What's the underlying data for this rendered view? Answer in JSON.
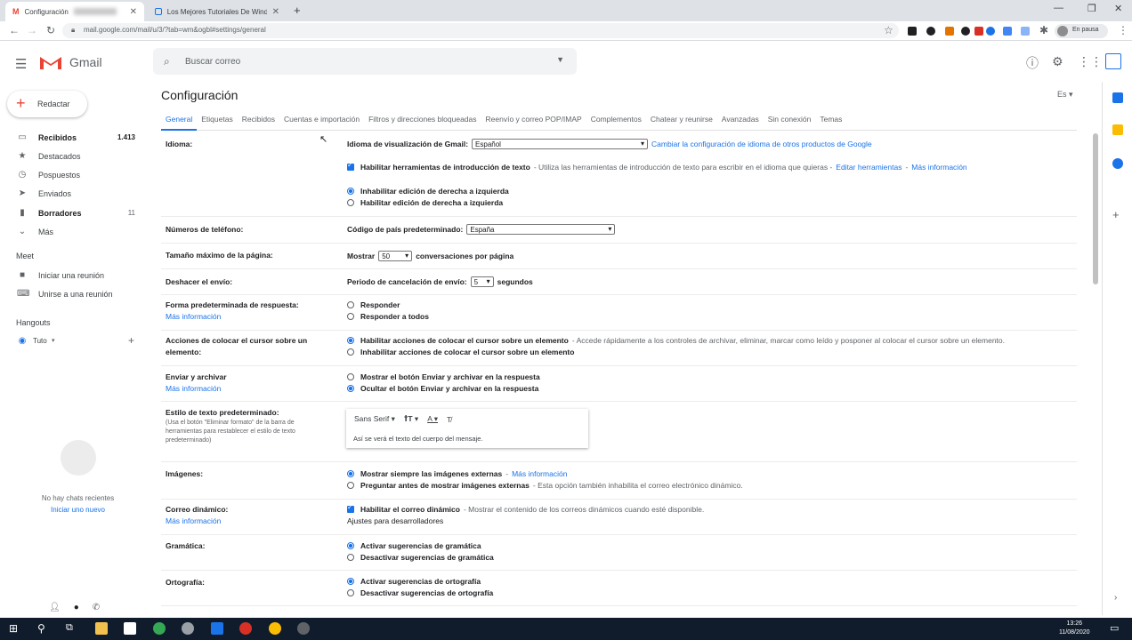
{
  "browser": {
    "tabs": [
      {
        "title": "Configuración",
        "favicon": "gmail-icon",
        "active": true
      },
      {
        "title": "Los Mejores Tutoriales De Windo",
        "favicon": "page-icon",
        "active": false
      }
    ],
    "url": "mail.google.com/mail/u/3/?tab=wm&ogbl#settings/general",
    "profile_status": "En pausa"
  },
  "gmail": {
    "logo_text": "Gmail",
    "search_placeholder": "Buscar correo",
    "compose_label": "Redactar",
    "nav": [
      {
        "icon": "inbox-icon",
        "label": "Recibidos",
        "count": "1.413",
        "bold": true
      },
      {
        "icon": "star-icon",
        "label": "Destacados",
        "count": ""
      },
      {
        "icon": "clock-icon",
        "label": "Pospuestos",
        "count": ""
      },
      {
        "icon": "send-icon",
        "label": "Enviados",
        "count": ""
      },
      {
        "icon": "draft-icon",
        "label": "Borradores",
        "count": "11",
        "bold": true
      },
      {
        "icon": "chevron-down-icon",
        "label": "Más",
        "count": ""
      }
    ],
    "meet": {
      "title": "Meet",
      "items": [
        "Iniciar una reunión",
        "Unirse a una reunión"
      ]
    },
    "hangouts": {
      "title": "Hangouts",
      "user": "Tuto",
      "no_chats": "No hay chats recientes",
      "start_new": "Iniciar uno nuevo"
    }
  },
  "settings": {
    "title": "Configuración",
    "lang_short": "Es",
    "tabs": [
      "General",
      "Etiquetas",
      "Recibidos",
      "Cuentas e importación",
      "Filtros y direcciones bloqueadas",
      "Reenvío y correo POP/IMAP",
      "Complementos",
      "Chatear y reunirse",
      "Avanzadas",
      "Sin conexión",
      "Temas"
    ],
    "idioma": {
      "label": "Idioma:",
      "display_label": "Idioma de visualización de Gmail:",
      "display_value": "Español",
      "other_link": "Cambiar la configuración de idioma de otros productos de Google",
      "tools_label": "Habilitar herramientas de introducción de texto",
      "tools_desc": "- Utiliza las herramientas de introducción de texto para escribir en el idioma que quieras -",
      "tools_edit": "Editar herramientas",
      "tools_sep": "-",
      "tools_more": "Más información",
      "rtl_off": "Inhabilitar edición de derecha a izquierda",
      "rtl_on": "Habilitar edición de derecha a izquierda"
    },
    "telefono": {
      "label": "Números de teléfono:",
      "code_label": "Código de país predeterminado:",
      "code_value": "España"
    },
    "pagina": {
      "label": "Tamaño máximo de la página:",
      "show": "Mostrar",
      "value": "50",
      "suffix": "conversaciones por página"
    },
    "deshacer": {
      "label": "Deshacer el envío:",
      "period_label": "Periodo de cancelación de envío:",
      "value": "5",
      "suffix": "segundos"
    },
    "respuesta": {
      "label": "Forma predeterminada de respuesta:",
      "more": "Más información",
      "opt1": "Responder",
      "opt2": "Responder a todos"
    },
    "cursor": {
      "label": "Acciones de colocar el cursor sobre un elemento:",
      "opt1": "Habilitar acciones de colocar el cursor sobre un elemento",
      "opt1_desc": "- Accede rápidamente a los controles de archivar, eliminar, marcar como leído y posponer al colocar el cursor sobre un elemento.",
      "opt2": "Inhabilitar acciones de colocar el cursor sobre un elemento"
    },
    "archivar": {
      "label": "Enviar y archivar",
      "more": "Más información",
      "opt1": "Mostrar el botón Enviar y archivar en la respuesta",
      "opt2": "Ocultar el botón Enviar y archivar en la respuesta"
    },
    "estilo": {
      "label": "Estilo de texto predeterminado:",
      "sub": "(Usa el botón \"Eliminar formato\" de la barra de herramientas para restablecer el estilo de texto predeterminado)",
      "font": "Sans Serif",
      "preview": "Así se verá el texto del cuerpo del mensaje."
    },
    "imagenes": {
      "label": "Imágenes:",
      "opt1": "Mostrar siempre las imágenes externas",
      "opt1_sep": "-",
      "opt1_link": "Más información",
      "opt2": "Preguntar antes de mostrar imágenes externas",
      "opt2_desc": "- Esta opción también inhabilita el correo electrónico dinámico."
    },
    "dinamico": {
      "label": "Correo dinámico:",
      "more": "Más información",
      "opt": "Habilitar el correo dinámico",
      "opt_desc": "- Mostrar el contenido de los correos dinámicos cuando esté disponible.",
      "dev_link": "Ajustes para desarrolladores"
    },
    "gramatica": {
      "label": "Gramática:",
      "opt1": "Activar sugerencias de gramática",
      "opt2": "Desactivar sugerencias de gramática"
    },
    "ortografia": {
      "label": "Ortografía:",
      "opt1": "Activar sugerencias de ortografía",
      "opt2": "Desactivar sugerencias de ortografía"
    }
  },
  "taskbar": {
    "time": "13:26",
    "date": "11/08/2020"
  },
  "colors": {
    "accent": "#1a73e8",
    "gmail_red": "#ea4335"
  }
}
